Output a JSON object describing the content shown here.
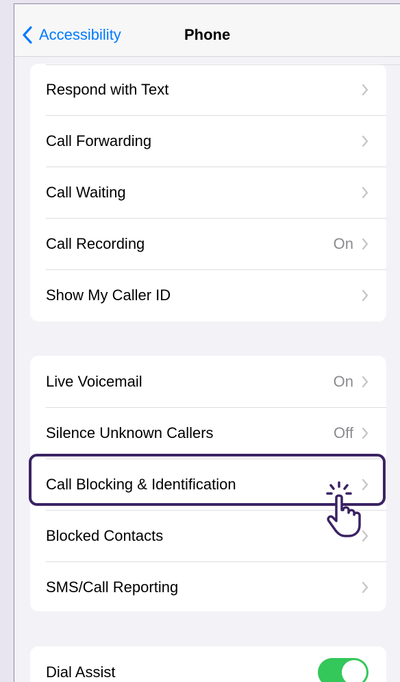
{
  "nav": {
    "back_label": "Accessibility",
    "title": "Phone"
  },
  "group1": [
    {
      "label": "Respond with Text",
      "value": ""
    },
    {
      "label": "Call Forwarding",
      "value": ""
    },
    {
      "label": "Call Waiting",
      "value": ""
    },
    {
      "label": "Call Recording",
      "value": "On"
    },
    {
      "label": "Show My Caller ID",
      "value": ""
    }
  ],
  "group2": [
    {
      "label": "Live Voicemail",
      "value": "On"
    },
    {
      "label": "Silence Unknown Callers",
      "value": "Off"
    },
    {
      "label": "Call Blocking & Identification",
      "value": ""
    },
    {
      "label": "Blocked Contacts",
      "value": ""
    },
    {
      "label": "SMS/Call Reporting",
      "value": ""
    }
  ],
  "group3": [
    {
      "label": "Dial Assist",
      "toggle_on": true
    }
  ],
  "colors": {
    "accent": "#007aff",
    "toggle_on": "#34c759",
    "highlight": "#3b2363"
  }
}
